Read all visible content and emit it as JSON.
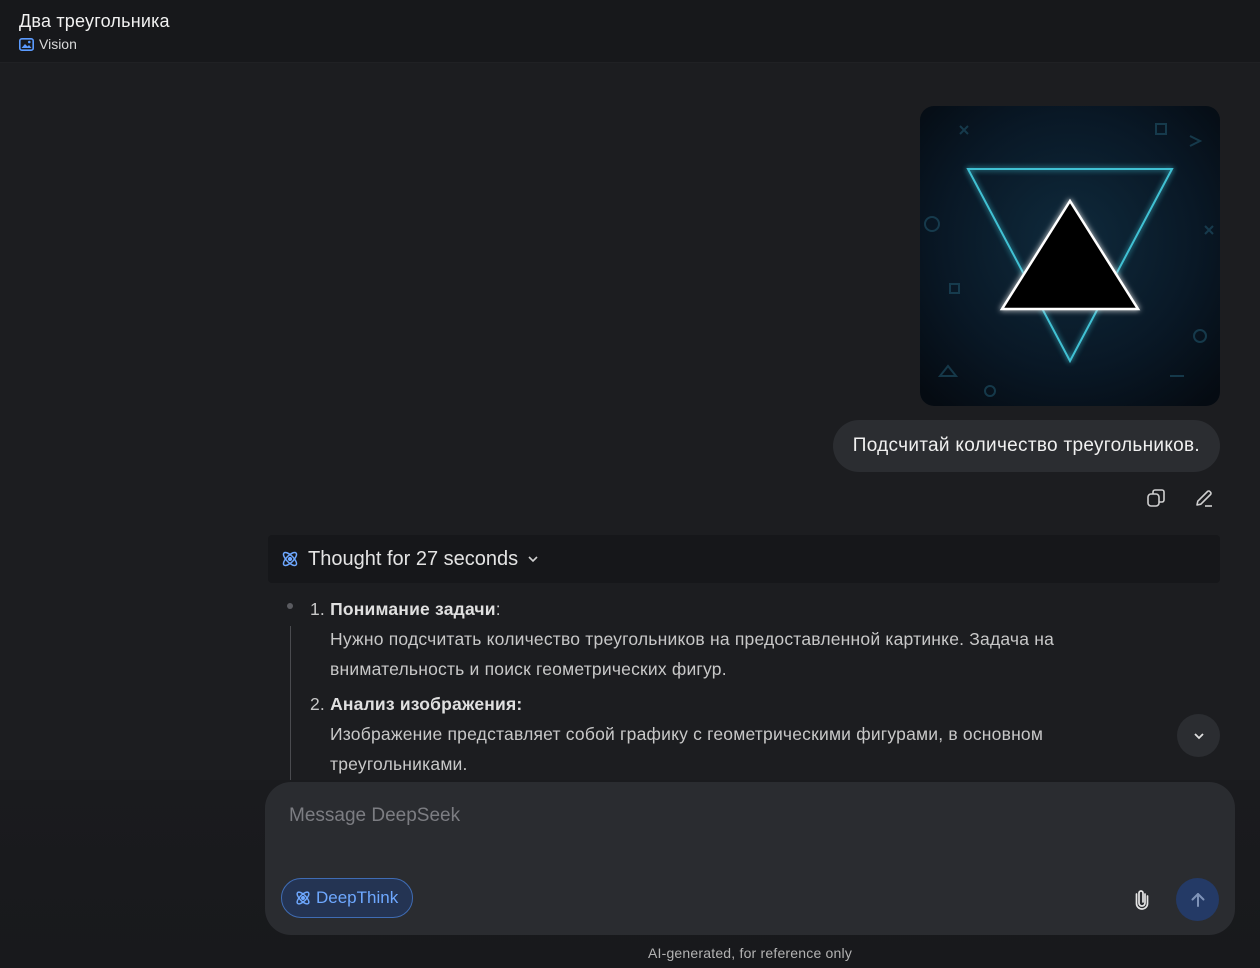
{
  "header": {
    "title": "Два треугольника",
    "model_label": "Vision"
  },
  "conversation": {
    "user_message": "Подсчитай количество треугольников.",
    "user_image_icon": "neon-triangles-image",
    "thought_summary": "Thought for 27 seconds",
    "steps": [
      {
        "number": "1.",
        "title": "Понимание задачи",
        "suffix": ":",
        "body_line1": "Нужно подсчитать количество треугольников на предоставленной картинке. Задача на",
        "body_line2": "внимательность и поиск геометрических фигур."
      },
      {
        "number": "2.",
        "title": "Анализ изображения:",
        "suffix": "",
        "body_line1": "Изображение представляет собой графику с геометрическими фигурами, в основном",
        "body_line2": "треугольниками."
      }
    ]
  },
  "composer": {
    "placeholder": "Message DeepSeek",
    "value": "",
    "deepthink_label": "DeepThink"
  },
  "footer": {
    "note": "AI-generated, for reference only"
  },
  "colors": {
    "accent": "#6ea8ff",
    "background": "#1c1d20",
    "bubble": "#2b2d31"
  }
}
